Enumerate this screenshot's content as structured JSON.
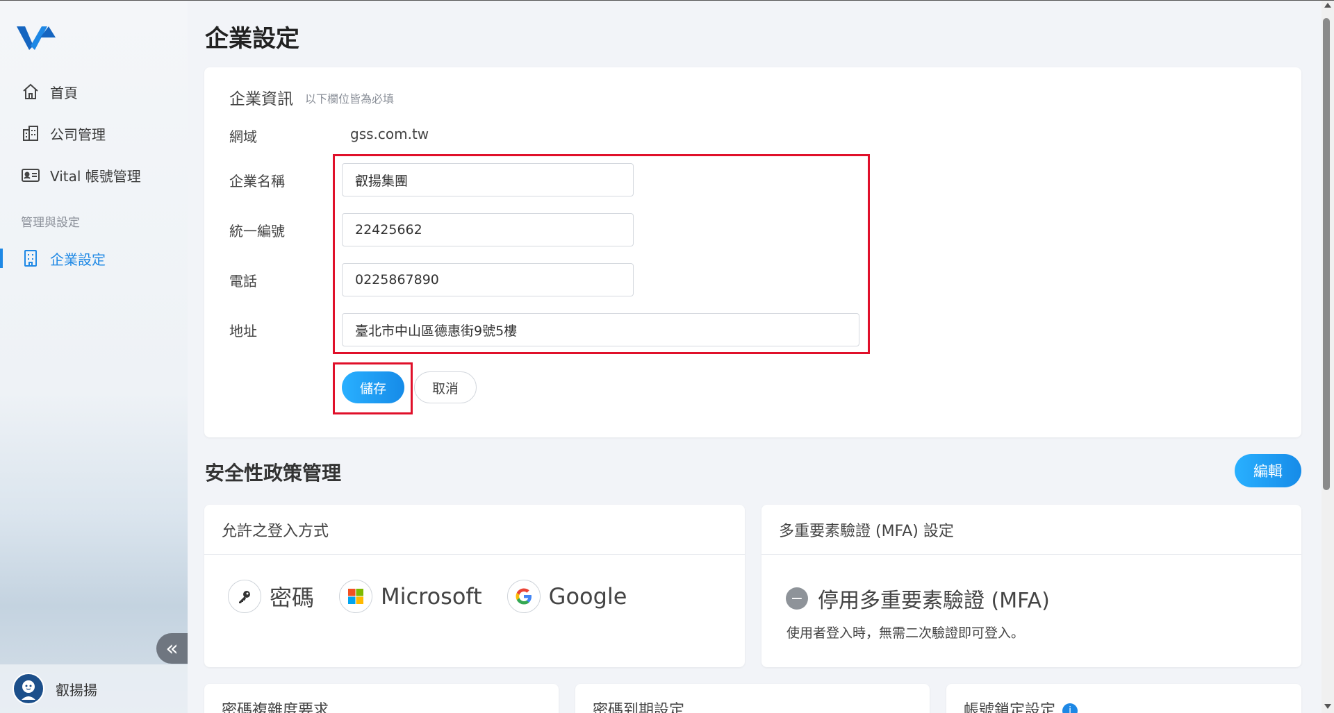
{
  "sidebar": {
    "items": [
      {
        "label": "首頁",
        "icon": "home-icon"
      },
      {
        "label": "公司管理",
        "icon": "building-icon"
      },
      {
        "label": "Vital 帳號管理",
        "icon": "id-card-icon"
      }
    ],
    "section_label": "管理與設定",
    "active_item": {
      "label": "企業設定",
      "icon": "office-building-icon"
    },
    "collapse_label": "«",
    "user_name": "叡揚揚"
  },
  "page": {
    "title": "企業設定"
  },
  "company_info": {
    "title": "企業資訊",
    "subtitle": "以下欄位皆為必填",
    "domain_label": "網域",
    "domain_value": "gss.com.tw",
    "name_label": "企業名稱",
    "name_value": "叡揚集團",
    "tax_id_label": "統一編號",
    "tax_id_value": "22425662",
    "phone_label": "電話",
    "phone_value": "0225867890",
    "address_label": "地址",
    "address_value": "臺北市中山區德惠街9號5樓",
    "save_label": "儲存",
    "cancel_label": "取消"
  },
  "security": {
    "title": "安全性政策管理",
    "edit_label": "編輯",
    "login_methods": {
      "title": "允許之登入方式",
      "methods": [
        {
          "label": "密碼",
          "icon": "key-icon"
        },
        {
          "label": "Microsoft",
          "icon": "microsoft-icon"
        },
        {
          "label": "Google",
          "icon": "google-icon"
        }
      ]
    },
    "mfa": {
      "title": "多重要素驗證 (MFA) 設定",
      "status": "停用多重要素驗證 (MFA)",
      "description": "使用者登入時，無需二次驗證即可登入。"
    },
    "password_complexity_title": "密碼複雜度要求",
    "password_expiry_title": "密碼到期設定",
    "account_lock_title": "帳號鎖定設定"
  },
  "colors": {
    "accent": "#1e88e5",
    "highlight": "#e0102a",
    "button_gradient_start": "#29b0ff",
    "button_gradient_end": "#168be8"
  }
}
